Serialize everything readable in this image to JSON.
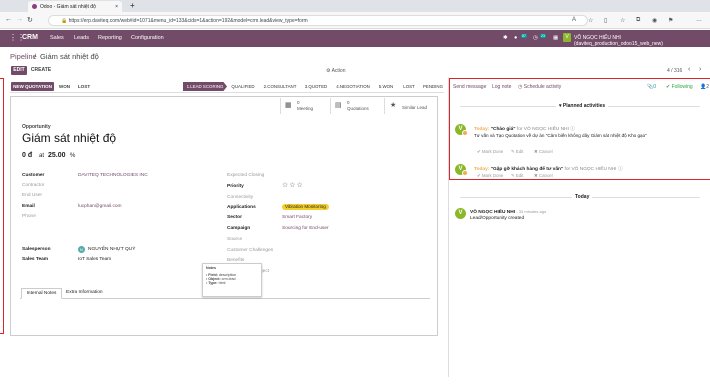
{
  "browser": {
    "tab_title": "Odoo - Giám sát nhiệt độ",
    "url": "https://erp.daviteq.com/web#id=1071&menu_id=133&cids=1&action=192&model=crm.lead&view_type=form",
    "new_tab": "+"
  },
  "menu": {
    "app": "CRM",
    "items": [
      "Sales",
      "Leads",
      "Reporting",
      "Configuration"
    ],
    "badge1": "87",
    "badge2": "23",
    "user": "VÕ NGỌC HIẾU NHI (daviteq_production_odoo15_web_new)"
  },
  "control": {
    "breadcrumb_root": "Pipeline",
    "breadcrumb_sep": "/",
    "breadcrumb_current": "Giám sát nhiệt độ",
    "edit": "EDIT",
    "create": "CREATE",
    "action": "⚙ Action",
    "pager": "4 / 316"
  },
  "statusbar": {
    "new_quotation": "NEW QUOTATION",
    "won": "WON",
    "lost": "LOST",
    "stages": [
      "1.LEAD SCORING",
      "QUALIFIED",
      "2.CONSULTANT",
      "3.QUOTED",
      "4.NEGOTIATION",
      "5.WON",
      "LOST",
      "PENDING"
    ]
  },
  "smart_buttons": {
    "meeting_count": "0",
    "meeting": "Meeting",
    "quotations_count": "0",
    "quotations": "Quotations",
    "similar": "Similar Lead"
  },
  "form": {
    "opp_label": "Opportunity",
    "name": "Giám sát nhiệt độ",
    "revenue": "0 đ",
    "at": "at",
    "probability": "25.00",
    "pct": "%",
    "left": {
      "customer_label": "Customer",
      "customer": "DAVITEQ TECHNOLOGIES INC",
      "contractor_label": "Contractor",
      "enduser_label": "End User",
      "email_label": "Email",
      "email": "lucphan@gmail.com",
      "phone_label": "Phone",
      "salesperson_label": "Salesperson",
      "salesperson": "NGUYỄN NHỰT QUÝ",
      "salesperson_initial": "N",
      "team_label": "Sales Team",
      "team": "IoT Sales Team"
    },
    "right": {
      "closing_label": "Expected Closing",
      "priority_label": "Priority",
      "connectivity_label": "Connectivity",
      "applications_label": "Applications",
      "applications": "Vibration Monitoring",
      "sector_label": "Sector",
      "sector": "Smart Factory",
      "campaign_label": "Campaign",
      "campaign": "Sourcing for End-user",
      "source_label": "Source",
      "challenges_label": "Customer Challenges",
      "benefits_label": "Benefits",
      "summary_label": "Summary of Project"
    },
    "tabs": [
      "Internal Notes",
      "Extra Information"
    ]
  },
  "tooltip": {
    "title": "Notes",
    "field_label": "Field:",
    "field": "description",
    "object_label": "Object:",
    "object": "crm.lead",
    "type_label": "Type:",
    "type": "html"
  },
  "chatter": {
    "send": "Send message",
    "log": "Log note",
    "schedule": "Schedule activity",
    "followers": "0",
    "following": "Following",
    "count": "2",
    "planned": "Planned activities",
    "activities": [
      {
        "when": "Today:",
        "title": "\"Chào giá\"",
        "for": "for VÕ NGỌC HIẾU NHI",
        "info": "ⓘ",
        "desc": "Tư vấn và Tạo Quotation về dự án \"Cảm biến không dây Giám sát nhiệt độ Kho gạo\"",
        "mark": "✔ Mark Done",
        "edit": "✎ Edit",
        "cancel": "✖ Cancel"
      },
      {
        "when": "Today:",
        "title": "\"Gặp gỡ khách hàng để tư vấn\"",
        "for": "for VÕ NGỌC HIẾU NHI",
        "info": "ⓘ",
        "desc": "",
        "mark": "✔ Mark Done",
        "edit": "✎ Edit",
        "cancel": "✖ Cancel"
      }
    ],
    "today": "Today",
    "msg_author": "VÕ NGỌC HIẾU NHI",
    "msg_time": "- 33 minutes ago",
    "msg_body": "Lead/Opportunity created",
    "avatar_initial": "V"
  }
}
